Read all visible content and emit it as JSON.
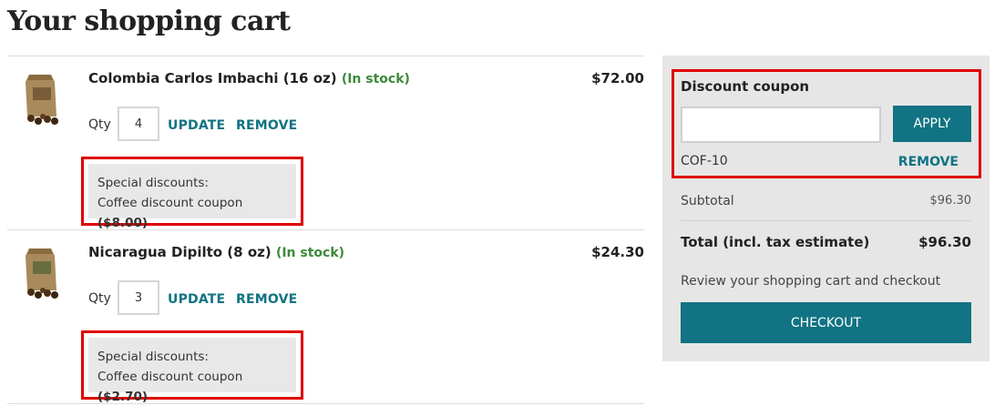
{
  "page": {
    "title": "Your shopping cart"
  },
  "cart": {
    "items": [
      {
        "name": "Colombia Carlos Imbachi (16 oz)",
        "stock": "(In stock)",
        "price": "$72.00",
        "qty_label": "Qty",
        "qty": "4",
        "update_label": "UPDATE",
        "remove_label": "REMOVE",
        "discount_heading": "Special discounts:",
        "discount_name": "Coffee discount coupon",
        "discount_amount": "($8.00)"
      },
      {
        "name": "Nicaragua Dipilto (8 oz)",
        "stock": "(In stock)",
        "price": "$24.30",
        "qty_label": "Qty",
        "qty": "3",
        "update_label": "UPDATE",
        "remove_label": "REMOVE",
        "discount_heading": "Special discounts:",
        "discount_name": "Coffee discount coupon",
        "discount_amount": "($2.70)"
      }
    ]
  },
  "summary": {
    "coupon_title": "Discount coupon",
    "coupon_input_value": "",
    "apply_label": "APPLY",
    "applied_code": "COF-10",
    "coupon_remove_label": "REMOVE",
    "subtotal_label": "Subtotal",
    "subtotal_value": "$96.30",
    "total_label": "Total (incl. tax estimate)",
    "total_value": "$96.30",
    "review_text": "Review your shopping cart and checkout",
    "checkout_label": "CHECKOUT"
  },
  "colors": {
    "accent": "#117383",
    "in_stock": "#3b8a3b",
    "highlight": "#e00000",
    "panel_bg": "#e6e6e6"
  },
  "icons": {
    "product_image": "coffee-bag-icon"
  }
}
